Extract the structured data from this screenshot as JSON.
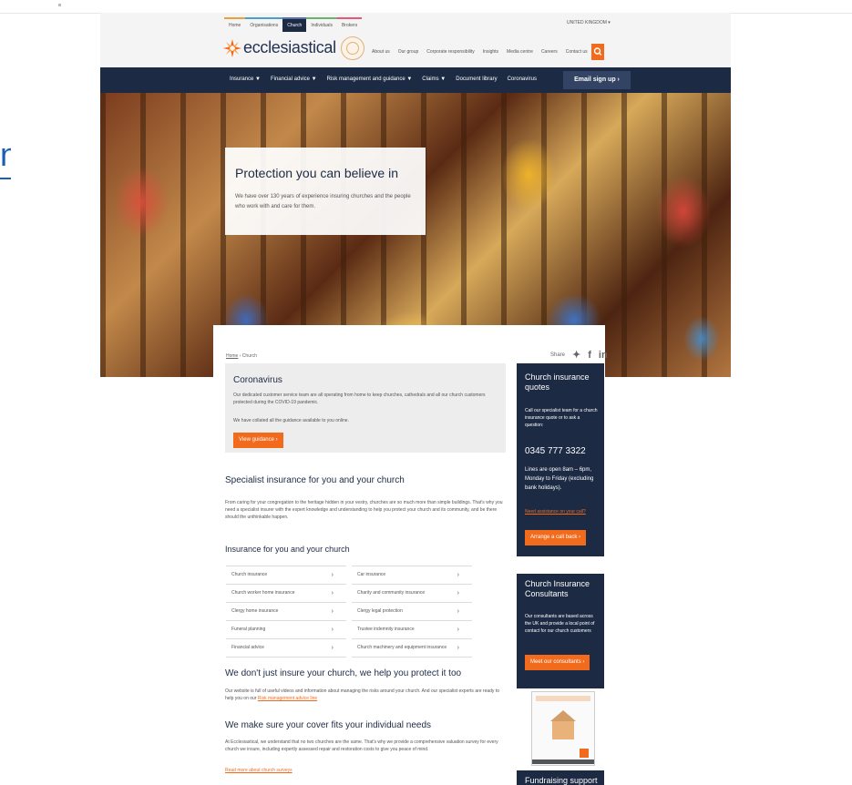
{
  "site_header": {
    "segment_tabs": [
      "Home",
      "Organisations",
      "Church",
      "Individuals",
      "Brokers"
    ],
    "country_selector": "UNITED KINGDOM",
    "logo_text": "ecclesiastical",
    "utility_nav": [
      "About us",
      "Our group",
      "Corporate responsibility",
      "Insights",
      "Media centre",
      "Careers",
      "Contact us"
    ]
  },
  "main_nav": {
    "items": [
      "Insurance ▼",
      "Financial advice ▼",
      "Risk management and guidance ▼",
      "Claims ▼",
      "Document library",
      "Coronavirus"
    ],
    "email_signup": "Email sign up ›"
  },
  "hero": {
    "title": "Protection you can believe in",
    "text": "We have over 130 years of experience insuring churches and the people who work with and care for them."
  },
  "breadcrumb": [
    "Home",
    "Church"
  ],
  "share": {
    "label": "Share"
  },
  "coronavirus_box": {
    "title": "Coronavirus",
    "text1": "Our dedicated customer service team are all operating from home to keep churches, cathedrals and all our church customers protected during the COVID-19 pandemic.",
    "text2": "We have collated all the guidance available to you online.",
    "button": "View guidance ›"
  },
  "specialist": {
    "title": "Specialist insurance for you and your church",
    "text": "From caring for your congregation to the heritage hidden in your vestry, churches are so much more than simple buildings. That's why you need a specialist insurer with the expert knowledge and understanding to help you protect your church and its community, and be there should the unthinkable happen."
  },
  "insurance_list": {
    "title": "Insurance for you and your church",
    "left": [
      "Church insurance",
      "Church worker home insurance",
      "Clergy home insurance",
      "Funeral planning",
      "Financial advice"
    ],
    "right": [
      "Car insurance",
      "Charity and community insurance",
      "Clergy legal protection",
      "Trustee indemnity insurance",
      "Church machinery and equipment insurance"
    ],
    "chevron": "›"
  },
  "protect": {
    "title": "We don't just insure your church, we help you protect it too",
    "text": "Our website is full of useful videos and information about managing the risks around your church. And our specialist experts are ready to help you on our",
    "link": "Risk management advice line"
  },
  "cover": {
    "title": "We make sure your cover fits your individual needs",
    "text": "At Ecclesiastical, we understand that no two churches are the same. That's why we provide a comprehensive valuation survey for every church we insure, including expertly assessed repair and restoration costs to give you peace of mind.",
    "link": "Read more about church surveys"
  },
  "quotes_card": {
    "title": "Church insurance quotes",
    "text": "Call our specialist team for a church insurance quote or to ask a question:",
    "phone": "0345 777 3322",
    "hours": "Lines are open 8am – 6pm, Monday to Friday (excluding bank holidays).",
    "link": "Need assistance on your call?",
    "button": "Arrange a call back ›"
  },
  "consultants_card": {
    "title": "Church Insurance Consultants",
    "text": "Our consultants are based across the UK and provide a local point of contact for our church customers",
    "button": "Meet our consultants ›"
  },
  "fundraising_card": {
    "title": "Fundraising support"
  },
  "colors": {
    "navy": "#1c2a44",
    "orange": "#f26b1d"
  }
}
